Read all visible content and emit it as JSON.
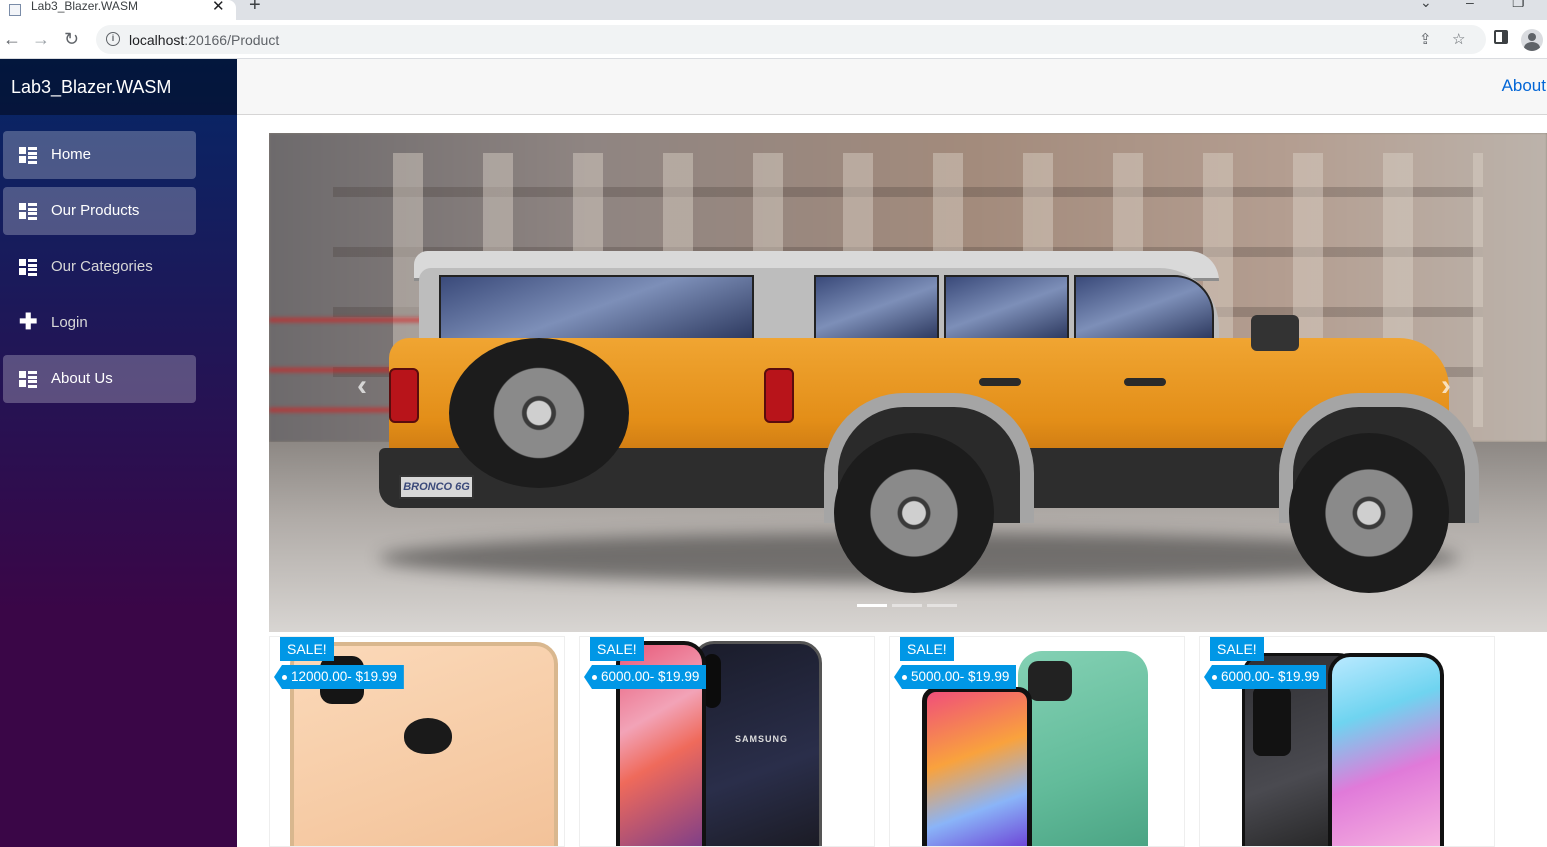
{
  "browser": {
    "tab_title": "Lab3_Blazer.WASM",
    "tab_close": "✕",
    "new_tab": "+",
    "url_host": "localhost",
    "url_path": ":20166/Product"
  },
  "sidebar": {
    "brand": "Lab3_Blazer.WASM",
    "items": [
      {
        "label": "Home",
        "icon": "list-icon",
        "active": true
      },
      {
        "label": "Our Products",
        "icon": "list-icon",
        "active": true
      },
      {
        "label": "Our Categories",
        "icon": "list-icon",
        "active": false
      },
      {
        "label": "Login",
        "icon": "plus-icon",
        "active": false
      },
      {
        "label": "About Us",
        "icon": "list-icon",
        "active": true
      }
    ]
  },
  "topbar": {
    "about": "About"
  },
  "carousel": {
    "plate_text": "BRONCO 6G",
    "slide_count": 3,
    "active_slide": 1
  },
  "products": [
    {
      "badge": "SALE!",
      "price": "12000.00- $19.99"
    },
    {
      "badge": "SALE!",
      "price": "6000.00- $19.99"
    },
    {
      "badge": "SALE!",
      "price": "5000.00- $19.99"
    },
    {
      "badge": "SALE!",
      "price": "6000.00- $19.99"
    }
  ],
  "phone_text": {
    "samsung_brand": "SAMSUNG"
  },
  "colors": {
    "accent": "#0097e6",
    "sidebar_top": "#052767",
    "sidebar_bottom": "#3a0647",
    "link": "#0366d6"
  }
}
